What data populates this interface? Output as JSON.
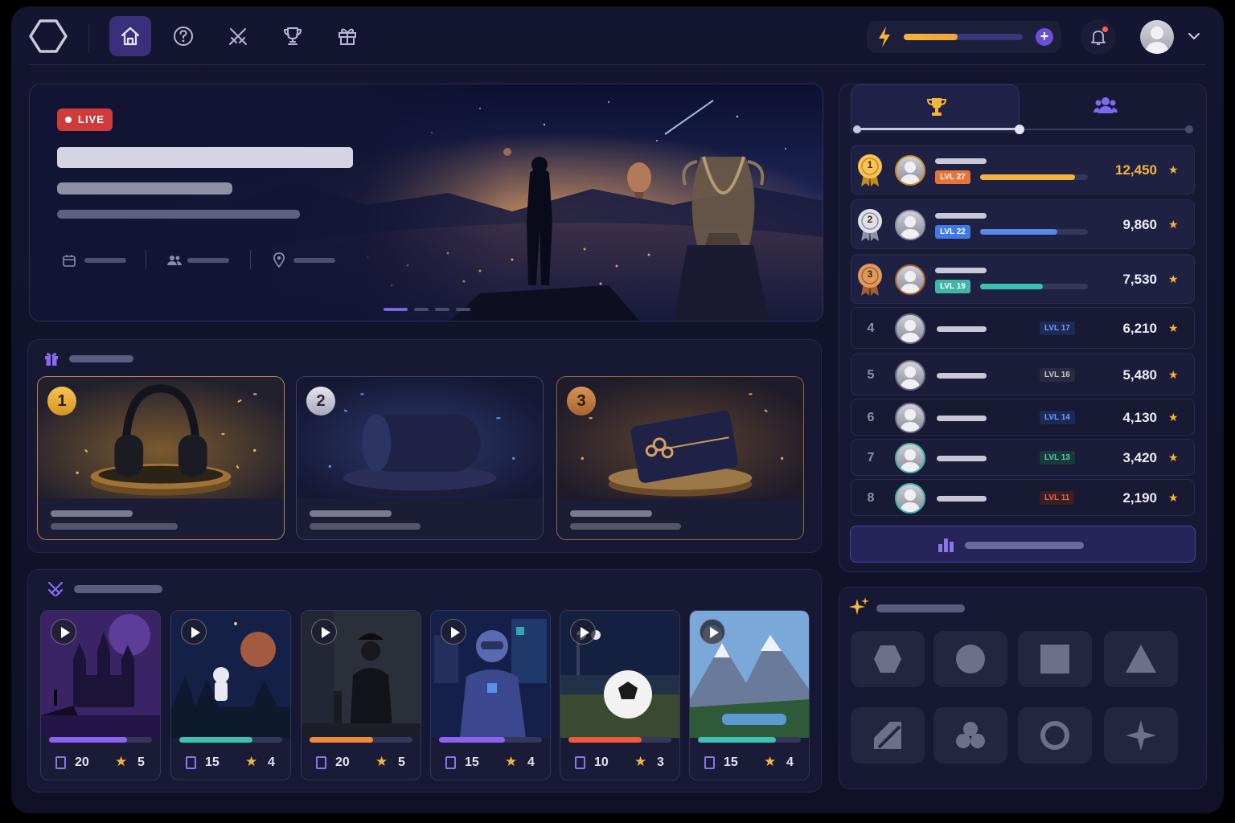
{
  "nav": {
    "items": [
      {
        "name": "home",
        "icon": "home-icon",
        "active": true
      },
      {
        "name": "help",
        "icon": "help-icon",
        "active": false
      },
      {
        "name": "battles",
        "icon": "crossed-swords-icon",
        "active": false
      },
      {
        "name": "trophies",
        "icon": "trophy-icon",
        "active": false
      },
      {
        "name": "rewards",
        "icon": "gift-icon",
        "active": false
      }
    ],
    "energy_level": 0.45,
    "has_notification": true
  },
  "hero": {
    "badge": "LIVE",
    "carousel": {
      "slides": 4,
      "active": 0
    }
  },
  "prizes": {
    "items": [
      {
        "rank": "1",
        "item": "headphones",
        "tier": "gold"
      },
      {
        "rank": "2",
        "item": "speaker",
        "tier": "silver"
      },
      {
        "rank": "3",
        "item": "gift-card",
        "tier": "bronze"
      }
    ]
  },
  "games": [
    {
      "theme": "castle",
      "progress": 0.76,
      "color": "#8a63ef",
      "docs": "20",
      "stars": "5"
    },
    {
      "theme": "astronaut",
      "progress": 0.71,
      "color": "#3fc1b0",
      "docs": "15",
      "stars": "4"
    },
    {
      "theme": "detective",
      "progress": 0.62,
      "color": "#f08a3a",
      "docs": "20",
      "stars": "5"
    },
    {
      "theme": "robot",
      "progress": 0.64,
      "color": "#8a63ef",
      "docs": "15",
      "stars": "4"
    },
    {
      "theme": "soccer",
      "progress": 0.71,
      "color": "#f05a3a",
      "docs": "10",
      "stars": "3"
    },
    {
      "theme": "mountains",
      "progress": 0.76,
      "color": "#3fc1b0",
      "docs": "15",
      "stars": "4"
    }
  ],
  "leaderboard": {
    "tabs": [
      {
        "icon": "trophy-icon",
        "active": true
      },
      {
        "icon": "users-icon",
        "active": false
      }
    ],
    "rows": [
      {
        "rank": "1",
        "level": "LVL 27",
        "score": "12,450",
        "progress": 0.88,
        "tier": "gold"
      },
      {
        "rank": "2",
        "level": "LVL 22",
        "score": "9,860",
        "progress": 0.72,
        "tier": "silver"
      },
      {
        "rank": "3",
        "level": "LVL 19",
        "score": "7,530",
        "progress": 0.58,
        "tier": "bronze"
      },
      {
        "rank": "4",
        "level": "LVL 17",
        "score": "6,210"
      },
      {
        "rank": "5",
        "level": "LVL 16",
        "score": "5,480"
      },
      {
        "rank": "6",
        "level": "LVL 14",
        "score": "4,130"
      },
      {
        "rank": "7",
        "level": "LVL 13",
        "score": "3,420"
      },
      {
        "rank": "8",
        "level": "LVL 11",
        "score": "2,190"
      }
    ]
  },
  "shapes": [
    "hexagon-icon",
    "circle-icon",
    "square-icon",
    "triangle-icon",
    "parallelogram-icon",
    "clover-icon",
    "ring-icon",
    "sparkle-icon"
  ],
  "colors": {
    "accent": "#7b64e8",
    "gold": "#f5b53c",
    "live": "#cf3b3b",
    "background": "#141530"
  }
}
